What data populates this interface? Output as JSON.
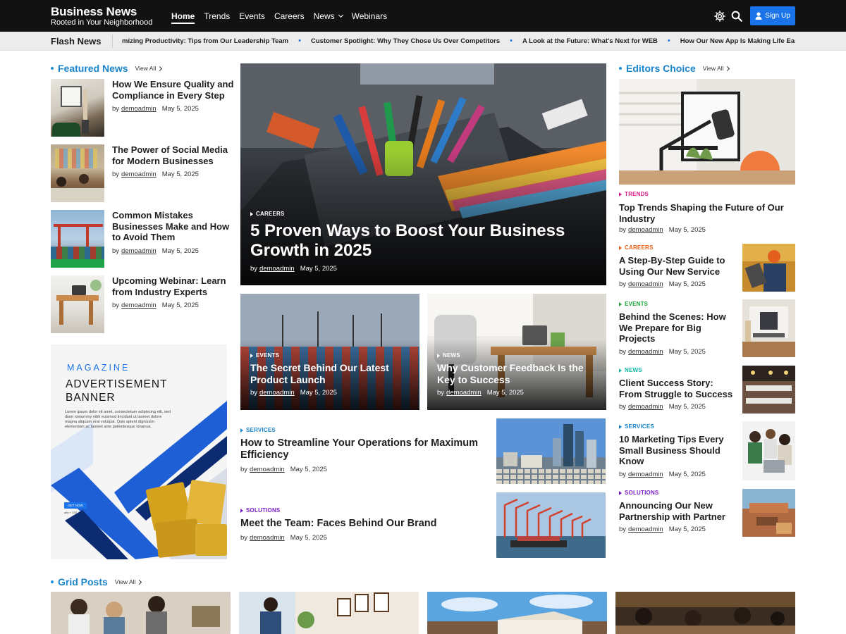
{
  "brand": {
    "title": "Business News",
    "tagline": "Rooted in Your Neighborhood"
  },
  "nav": {
    "items": [
      {
        "label": "Home",
        "active": true
      },
      {
        "label": "Trends"
      },
      {
        "label": "Events"
      },
      {
        "label": "Careers"
      },
      {
        "label": "News",
        "has_dropdown": true
      },
      {
        "label": "Webinars"
      }
    ],
    "icons": [
      "settings-icon",
      "search-icon"
    ],
    "signup_label": "Sign Up"
  },
  "flash": {
    "label": "Flash News",
    "items": [
      "mizing Productivity: Tips from Our Leadership Team",
      "Customer Spotlight: Why They Chose Us Over Competitors",
      "A Look at the Future: What's Next for WEB",
      "How Our New App Is Making Life Easier for"
    ]
  },
  "featured": {
    "title": "Featured News",
    "view_all": "View All",
    "items": [
      {
        "title": "How We Ensure Quality and Compliance in Every Step",
        "author": "demoadmin",
        "date": "May 5, 2025",
        "by": "by"
      },
      {
        "title": "The Power of Social Media for Modern Businesses",
        "author": "demoadmin",
        "date": "May 5, 2025",
        "by": "by"
      },
      {
        "title": "Common Mistakes Businesses Make and How to Avoid Them",
        "author": "demoadmin",
        "date": "May 5, 2025",
        "by": "by"
      },
      {
        "title": "Upcoming Webinar: Learn from Industry Experts",
        "author": "demoadmin",
        "date": "May 5, 2025",
        "by": "by"
      }
    ]
  },
  "ad": {
    "kicker": "MAGAZINE",
    "title": "ADVERTISEMENT BANNER",
    "body": "Lorem ipsum dolor sit amet, consectetuer adipiscing elit, sed diam nonummy nibh euismod tincidunt ut laoreet dolore magna aliquam erat volutpat. Quis aptent dignissim elementum ac laoreet ante pellentesque vivamus.",
    "button": "GET NOW",
    "sub": "ads + 33S",
    "colors": {
      "accent": "#1a73e8",
      "dark": "#0e2a6b",
      "gold": "#d4a21c"
    }
  },
  "hero": {
    "category": "CAREERS",
    "title": "5 Proven Ways to Boost Your Business Growth in 2025",
    "by": "by",
    "author": "demoadmin",
    "date": "May 5, 2025"
  },
  "cards": [
    {
      "category": "EVENTS",
      "title": "The Secret Behind Our Latest Product Launch",
      "by": "by",
      "author": "demoadmin",
      "date": "May 5, 2025"
    },
    {
      "category": "NEWS",
      "title": "Why Customer Feedback Is the Key to Success",
      "by": "by",
      "author": "demoadmin",
      "date": "May 5, 2025"
    }
  ],
  "mid_list": [
    {
      "category": "SERVICES",
      "category_color": "#1b85cc",
      "title": "How to Streamline Your Operations for Maximum Efficiency",
      "by": "by",
      "author": "demoadmin",
      "date": "May 5, 2025"
    },
    {
      "category": "SOLUTIONS",
      "category_color": "#7a1fc2",
      "title": "Meet the Team: Faces Behind Our Brand",
      "by": "by",
      "author": "demoadmin",
      "date": "May 5, 2025"
    }
  ],
  "editors": {
    "title": "Editors Choice",
    "view_all": "View All",
    "big": {
      "category": "TRENDS",
      "category_color": "#d61f8a",
      "title": "Top Trends Shaping the Future of Our Industry",
      "by": "by",
      "author": "demoadmin",
      "date": "May 5, 2025"
    },
    "items": [
      {
        "category": "CAREERS",
        "category_color": "#e8641a",
        "title": "A Step-By-Step Guide to Using Our New Service",
        "by": "by",
        "author": "demoadmin",
        "date": "May 5, 2025"
      },
      {
        "category": "EVENTS",
        "category_color": "#1fa33a",
        "title": "Behind the Scenes: How We Prepare for Big Projects",
        "by": "by",
        "author": "demoadmin",
        "date": "May 5, 2025"
      },
      {
        "category": "NEWS",
        "category_color": "#14b8a6",
        "title": "Client Success Story: From Struggle to Success",
        "by": "by",
        "author": "demoadmin",
        "date": "May 5, 2025"
      },
      {
        "category": "SERVICES",
        "category_color": "#1b85cc",
        "title": "10 Marketing Tips Every Small Business Should Know",
        "by": "by",
        "author": "demoadmin",
        "date": "May 5, 2025"
      },
      {
        "category": "SOLUTIONS",
        "category_color": "#7a1fc2",
        "title": "Announcing Our New Partnership with Partner",
        "by": "by",
        "author": "demoadmin",
        "date": "May 5, 2025"
      }
    ]
  },
  "grid": {
    "title": "Grid Posts",
    "view_all": "View All"
  }
}
